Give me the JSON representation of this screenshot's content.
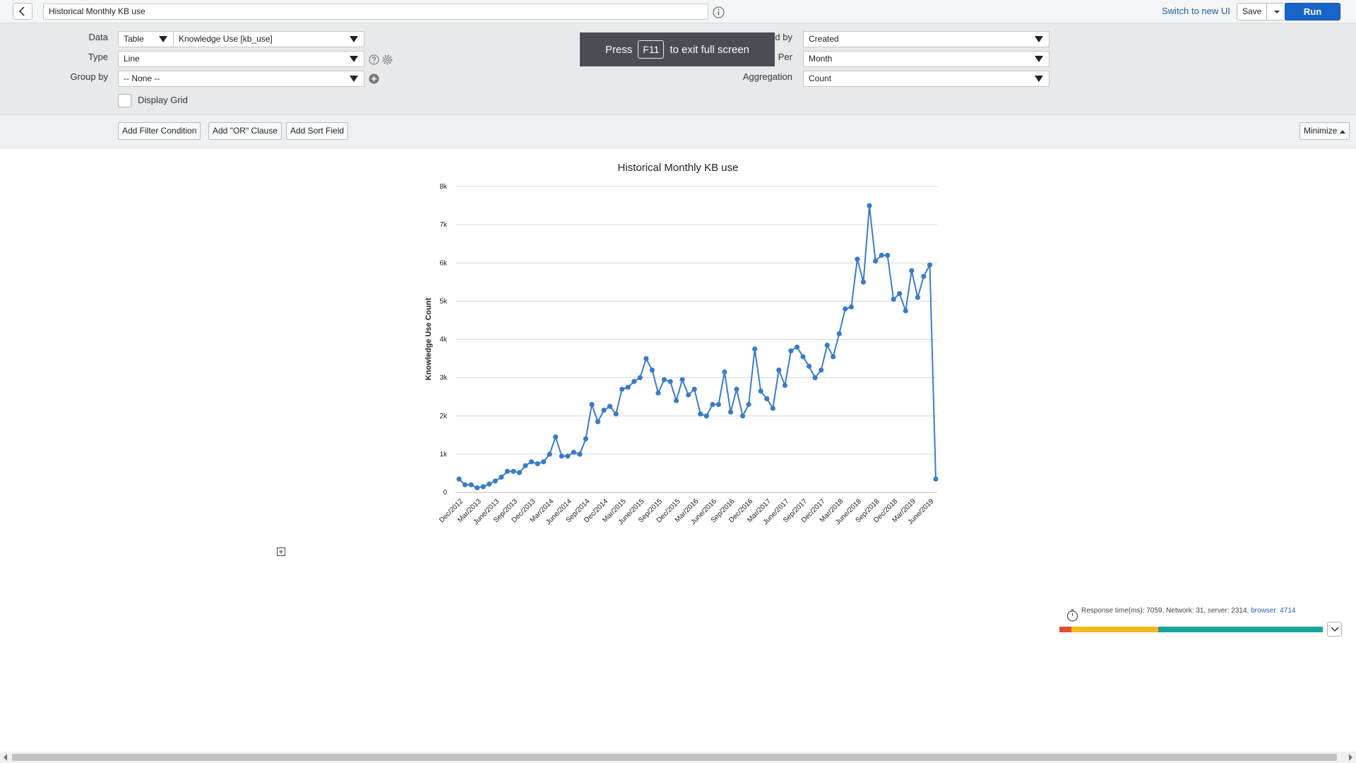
{
  "header": {
    "report_title": "Historical Monthly KB use",
    "switch_link": "Switch to new UI",
    "save_label": "Save",
    "run_label": "Run"
  },
  "settings": {
    "data_label": "Data",
    "data_source": "Table",
    "table_value": "Knowledge Use [kb_use]",
    "type_label": "Type",
    "type_value": "Line",
    "groupby_label": "Group by",
    "groupby_value": "-- None --",
    "display_grid_label": "Display Grid",
    "trendby_label": "Trend by",
    "trendby_value": "Created",
    "per_label": "Per",
    "per_value": "Month",
    "aggregation_label": "Aggregation",
    "aggregation_value": "Count"
  },
  "toast": {
    "prefix": "Press",
    "key": "F11",
    "suffix": "to exit full screen"
  },
  "filters": {
    "add_filter": "Add Filter Condition",
    "add_or": "Add \"OR\" Clause",
    "add_sort": "Add Sort Field",
    "minimize": "Minimize"
  },
  "response": {
    "text": "Response time(ms): 7059, Network: 31, server: 2314,",
    "browser_text": "browser: 4714",
    "segments": [
      {
        "color": "#e04b3a",
        "fraction": 0.046
      },
      {
        "color": "#f2b81f",
        "fraction": 0.33
      },
      {
        "color": "#1aa39a",
        "fraction": 0.624
      }
    ]
  },
  "colors": {
    "accent": "#1864c9",
    "line": "#3a7bc8"
  },
  "chart_data": {
    "type": "line",
    "title": "Historical Monthly KB use",
    "xlabel": "",
    "ylabel": "Knowledge Use Count",
    "ylim": [
      0,
      8000
    ],
    "yticks": [
      0,
      1000,
      2000,
      3000,
      4000,
      5000,
      6000,
      7000,
      8000
    ],
    "ytick_labels": [
      "0",
      "1k",
      "2k",
      "3k",
      "4k",
      "5k",
      "6k",
      "7k",
      "8k"
    ],
    "grid": true,
    "x_tick_labels": [
      "Dec/2012",
      "Mar/2013",
      "June/2013",
      "Sep/2013",
      "Dec/2013",
      "Mar/2014",
      "June/2014",
      "Sep/2014",
      "Dec/2014",
      "Mar/2015",
      "June/2015",
      "Sep/2015",
      "Dec/2015",
      "Mar/2016",
      "June/2016",
      "Sep/2016",
      "Dec/2016",
      "Mar/2017",
      "June/2017",
      "Sep/2017",
      "Dec/2017",
      "Mar/2018",
      "June/2018",
      "Sep/2018",
      "Dec/2018",
      "Mar/2019",
      "June/2019"
    ],
    "series": [
      {
        "values": [
          350,
          200,
          200,
          120,
          150,
          220,
          300,
          400,
          550,
          550,
          520,
          700,
          800,
          750,
          800,
          1000,
          1450,
          950,
          950,
          1050,
          1000,
          1400,
          2300,
          1850,
          2150,
          2250,
          2050,
          2700,
          2750,
          2900,
          3000,
          3500,
          3200,
          2600,
          2950,
          2900,
          2400,
          2950,
          2550,
          2700,
          2050,
          2000,
          2300,
          2300,
          3150,
          2100,
          2700,
          2000,
          2300,
          3750,
          2650,
          2450,
          2200,
          3200,
          2800,
          3700,
          3800,
          3550,
          3300,
          3000,
          3200,
          3850,
          3550,
          4150,
          4800,
          4850,
          6100,
          5500,
          7500,
          6050,
          6200,
          6200,
          5050,
          5200,
          4750,
          5800,
          5100,
          5650,
          5950,
          350
        ]
      }
    ]
  }
}
